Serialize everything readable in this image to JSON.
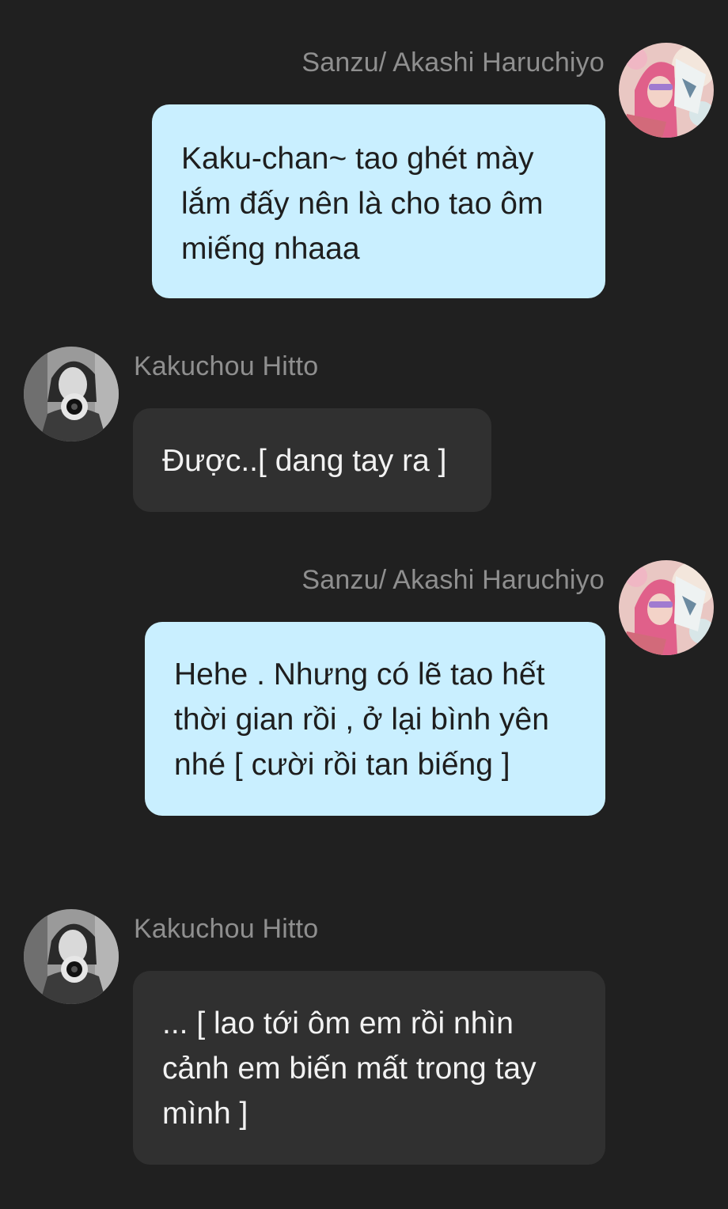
{
  "messages": [
    {
      "sender": "Sanzu/ Akashi Haruchiyo",
      "avatar_icon": "sanzu-avatar-icon",
      "direction": "outgoing",
      "text": "Kaku-chan~ tao ghét mày lắm đấy nên là cho tao ôm miếng nhaaa"
    },
    {
      "sender": "Kakuchou Hitto",
      "avatar_icon": "kakucho-avatar-icon",
      "direction": "incoming",
      "text": "Được..[ dang tay ra ]"
    },
    {
      "sender": "Sanzu/ Akashi Haruchiyo",
      "avatar_icon": "sanzu-avatar-icon",
      "direction": "outgoing",
      "text": "Hehe . Nhưng có lẽ tao hết thời gian rồi , ở lại bình yên nhé [ cười rồi tan biếng ]"
    },
    {
      "sender": "Kakuchou Hitto",
      "avatar_icon": "kakucho-avatar-icon",
      "direction": "incoming",
      "text": "... [ lao tới ôm em rồi nhìn cảnh em biến mất trong tay mình ]"
    }
  ],
  "colors": {
    "background": "#202020",
    "outgoing_bubble": "#c9efff",
    "incoming_bubble": "#303030",
    "sender_name": "#8f8f8f"
  }
}
